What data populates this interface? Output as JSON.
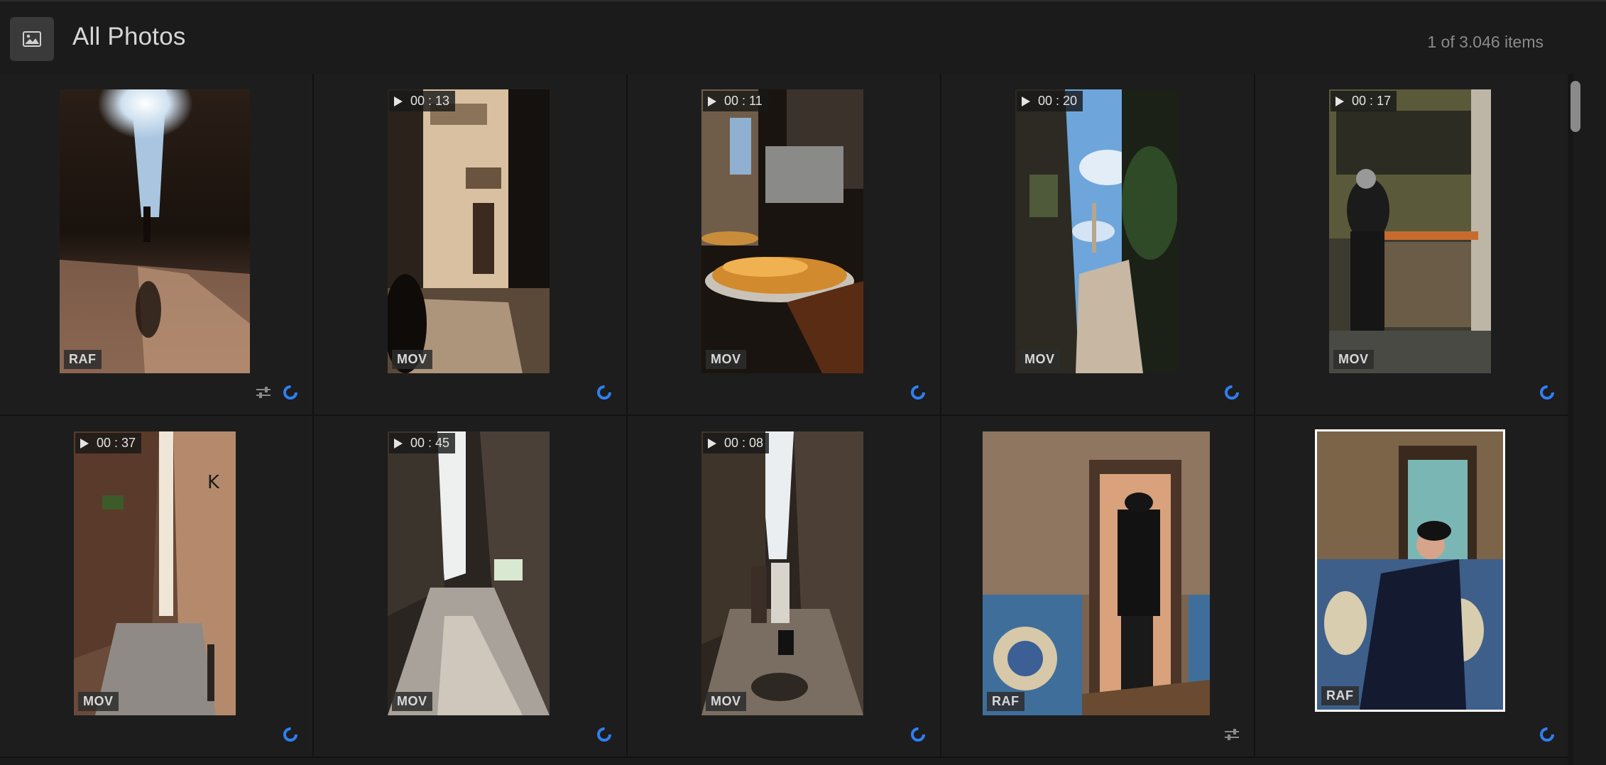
{
  "header": {
    "title": "All Photos",
    "icon": "photo-library-icon",
    "count_text": "1 of 3.046 items"
  },
  "colors": {
    "background": "#1b1b1b",
    "spinner_blue": "#2f7ff0",
    "selection": "#ffffff"
  },
  "items": [
    {
      "format": "RAF",
      "duration": null,
      "edited": true,
      "selected": false
    },
    {
      "format": "MOV",
      "duration": "00 : 13",
      "edited": false,
      "selected": false
    },
    {
      "format": "MOV",
      "duration": "00 : 11",
      "edited": false,
      "selected": false
    },
    {
      "format": "MOV",
      "duration": "00 : 20",
      "edited": false,
      "selected": false
    },
    {
      "format": "MOV",
      "duration": "00 : 17",
      "edited": false,
      "selected": false
    },
    {
      "format": "MOV",
      "duration": "00 : 37",
      "edited": false,
      "selected": false
    },
    {
      "format": "MOV",
      "duration": "00 : 45",
      "edited": false,
      "selected": false
    },
    {
      "format": "MOV",
      "duration": "00 : 08",
      "edited": false,
      "selected": false
    },
    {
      "format": "RAF",
      "duration": null,
      "edited": true,
      "selected": false
    },
    {
      "format": "RAF",
      "duration": null,
      "edited": false,
      "selected": true
    }
  ]
}
